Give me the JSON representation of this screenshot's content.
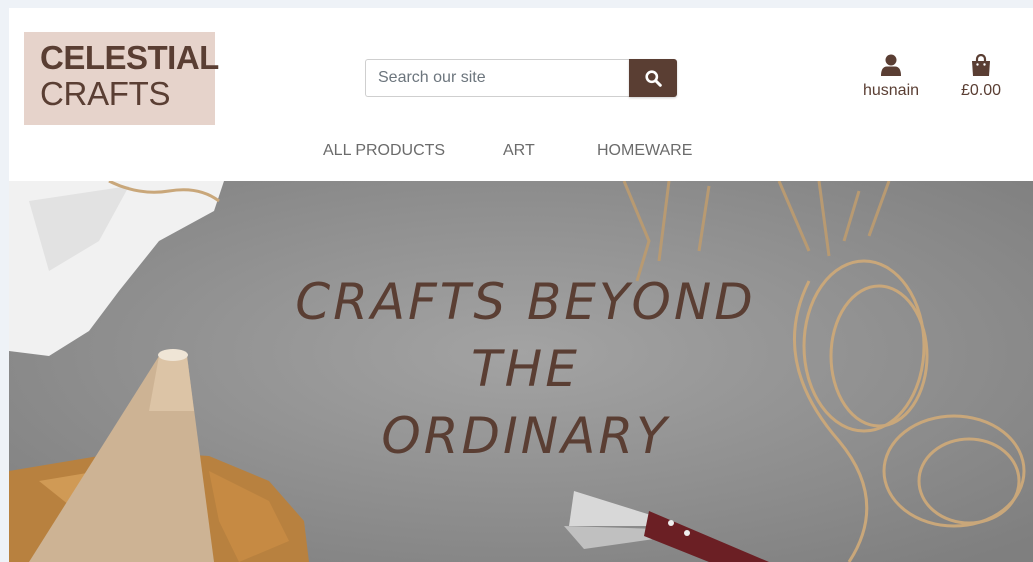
{
  "logo": {
    "line1": "CELESTIAL",
    "line2": "CRAFTS"
  },
  "search": {
    "placeholder": "Search our site",
    "button_icon": "search-icon"
  },
  "account": {
    "icon": "user-icon",
    "label": "husnain"
  },
  "bag": {
    "icon": "shopping-bag-icon",
    "total": "£0.00"
  },
  "nav": {
    "items": [
      "ALL PRODUCTS",
      "ART",
      "HOMEWARE"
    ]
  },
  "hero": {
    "lines": [
      "CRAFTS BEYOND",
      "THE",
      "ORDINARY"
    ]
  },
  "colors": {
    "brand": "#5a3e33",
    "logo_bg": "#e6d3cb",
    "hero_bg": "#8e8e8e"
  }
}
